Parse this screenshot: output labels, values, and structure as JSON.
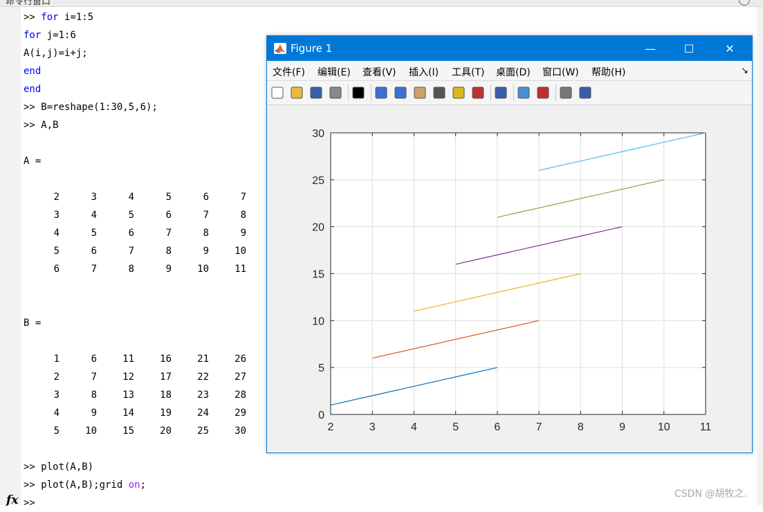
{
  "command_window": {
    "title": "命令行窗口",
    "lines_top": [
      {
        "prompt": ">> ",
        "kw": "for",
        "rest": " i=1:5"
      },
      {
        "prompt": "",
        "kw": "for",
        "rest": " j=1:6"
      },
      {
        "prompt": "",
        "kw": "",
        "rest": "A(i,j)=i+j;"
      },
      {
        "prompt": "",
        "kw": "end",
        "rest": ""
      },
      {
        "prompt": "",
        "kw": "end",
        "rest": ""
      },
      {
        "prompt": ">> ",
        "kw": "",
        "rest": "B=reshape(1:30,5,6);"
      },
      {
        "prompt": ">> ",
        "kw": "",
        "rest": "A,B"
      }
    ],
    "var_a_label": "A =",
    "matrix_a": [
      [
        "2",
        "3",
        "4",
        "5",
        "6",
        "7"
      ],
      [
        "3",
        "4",
        "5",
        "6",
        "7",
        "8"
      ],
      [
        "4",
        "5",
        "6",
        "7",
        "8",
        "9"
      ],
      [
        "5",
        "6",
        "7",
        "8",
        "9",
        "10"
      ],
      [
        "6",
        "7",
        "8",
        "9",
        "10",
        "11"
      ]
    ],
    "var_b_label": "B =",
    "matrix_b": [
      [
        "1",
        "6",
        "11",
        "16",
        "21",
        "26"
      ],
      [
        "2",
        "7",
        "12",
        "17",
        "22",
        "27"
      ],
      [
        "3",
        "8",
        "13",
        "18",
        "23",
        "28"
      ],
      [
        "4",
        "9",
        "14",
        "19",
        "24",
        "29"
      ],
      [
        "5",
        "10",
        "15",
        "20",
        "25",
        "30"
      ]
    ],
    "cmd_plot": ">> plot(A,B)",
    "cmd_grid_prefix": ">> plot(A,B);grid ",
    "cmd_grid_keyword": "on",
    "cmd_grid_suffix": ";",
    "prompt_last": ">>",
    "fx_label": "fx"
  },
  "figure": {
    "title": "Figure 1",
    "controls": {
      "minimize": "—",
      "maximize": "☐",
      "close": "✕"
    },
    "menu": [
      "文件(F)",
      "编辑(E)",
      "查看(V)",
      "插入(I)",
      "工具(T)",
      "桌面(D)",
      "窗口(W)",
      "帮助(H)"
    ],
    "menu_arrow": "↘",
    "toolbar": [
      {
        "name": "new-figure-icon",
        "color": "#ffffff"
      },
      {
        "name": "open-file-icon",
        "color": "#e8b93a"
      },
      {
        "name": "save-icon",
        "color": "#3a5fa8"
      },
      {
        "name": "print-icon",
        "color": "#888888"
      },
      {
        "sep": true
      },
      {
        "name": "pointer-icon",
        "color": "#000000"
      },
      {
        "sep": true
      },
      {
        "name": "zoom-in-icon",
        "color": "#3a6fd8"
      },
      {
        "name": "zoom-out-icon",
        "color": "#3a6fd8"
      },
      {
        "name": "pan-icon",
        "color": "#c9a26a"
      },
      {
        "name": "rotate-3d-icon",
        "color": "#555555"
      },
      {
        "name": "data-cursor-icon",
        "color": "#d8b820"
      },
      {
        "name": "brush-icon",
        "color": "#c03030"
      },
      {
        "sep": true
      },
      {
        "name": "link-plot-icon",
        "color": "#3a5fa8"
      },
      {
        "sep": true
      },
      {
        "name": "colorbar-icon",
        "color": "#4a90d8"
      },
      {
        "name": "legend-icon",
        "color": "#c03030"
      },
      {
        "sep": true
      },
      {
        "name": "hide-plot-tools-icon",
        "color": "#777777"
      },
      {
        "name": "show-plot-tools-icon",
        "color": "#3a5fa8"
      }
    ]
  },
  "chart_data": {
    "type": "line",
    "xlim": [
      2,
      11
    ],
    "ylim": [
      0,
      30
    ],
    "xticks": [
      "2",
      "3",
      "4",
      "5",
      "6",
      "7",
      "8",
      "9",
      "10",
      "11"
    ],
    "yticks": [
      "0",
      "5",
      "10",
      "15",
      "20",
      "25",
      "30"
    ],
    "grid": true,
    "series": [
      {
        "x": [
          2,
          3,
          4,
          5,
          6
        ],
        "y": [
          1,
          2,
          3,
          4,
          5
        ],
        "color": "#0072bd"
      },
      {
        "x": [
          3,
          4,
          5,
          6,
          7
        ],
        "y": [
          6,
          7,
          8,
          9,
          10
        ],
        "color": "#d95319"
      },
      {
        "x": [
          4,
          5,
          6,
          7,
          8
        ],
        "y": [
          11,
          12,
          13,
          14,
          15
        ],
        "color": "#edb120"
      },
      {
        "x": [
          5,
          6,
          7,
          8,
          9
        ],
        "y": [
          16,
          17,
          18,
          19,
          20
        ],
        "color": "#7e2f8e"
      },
      {
        "x": [
          6,
          7,
          8,
          9,
          10
        ],
        "y": [
          21,
          22,
          23,
          24,
          25
        ],
        "color": "#77ac30"
      },
      {
        "x": [
          7,
          8,
          9,
          10,
          11
        ],
        "y": [
          26,
          27,
          28,
          29,
          30
        ],
        "color": "#4dbeee"
      }
    ]
  },
  "watermark": "CSDN @胡牧之."
}
